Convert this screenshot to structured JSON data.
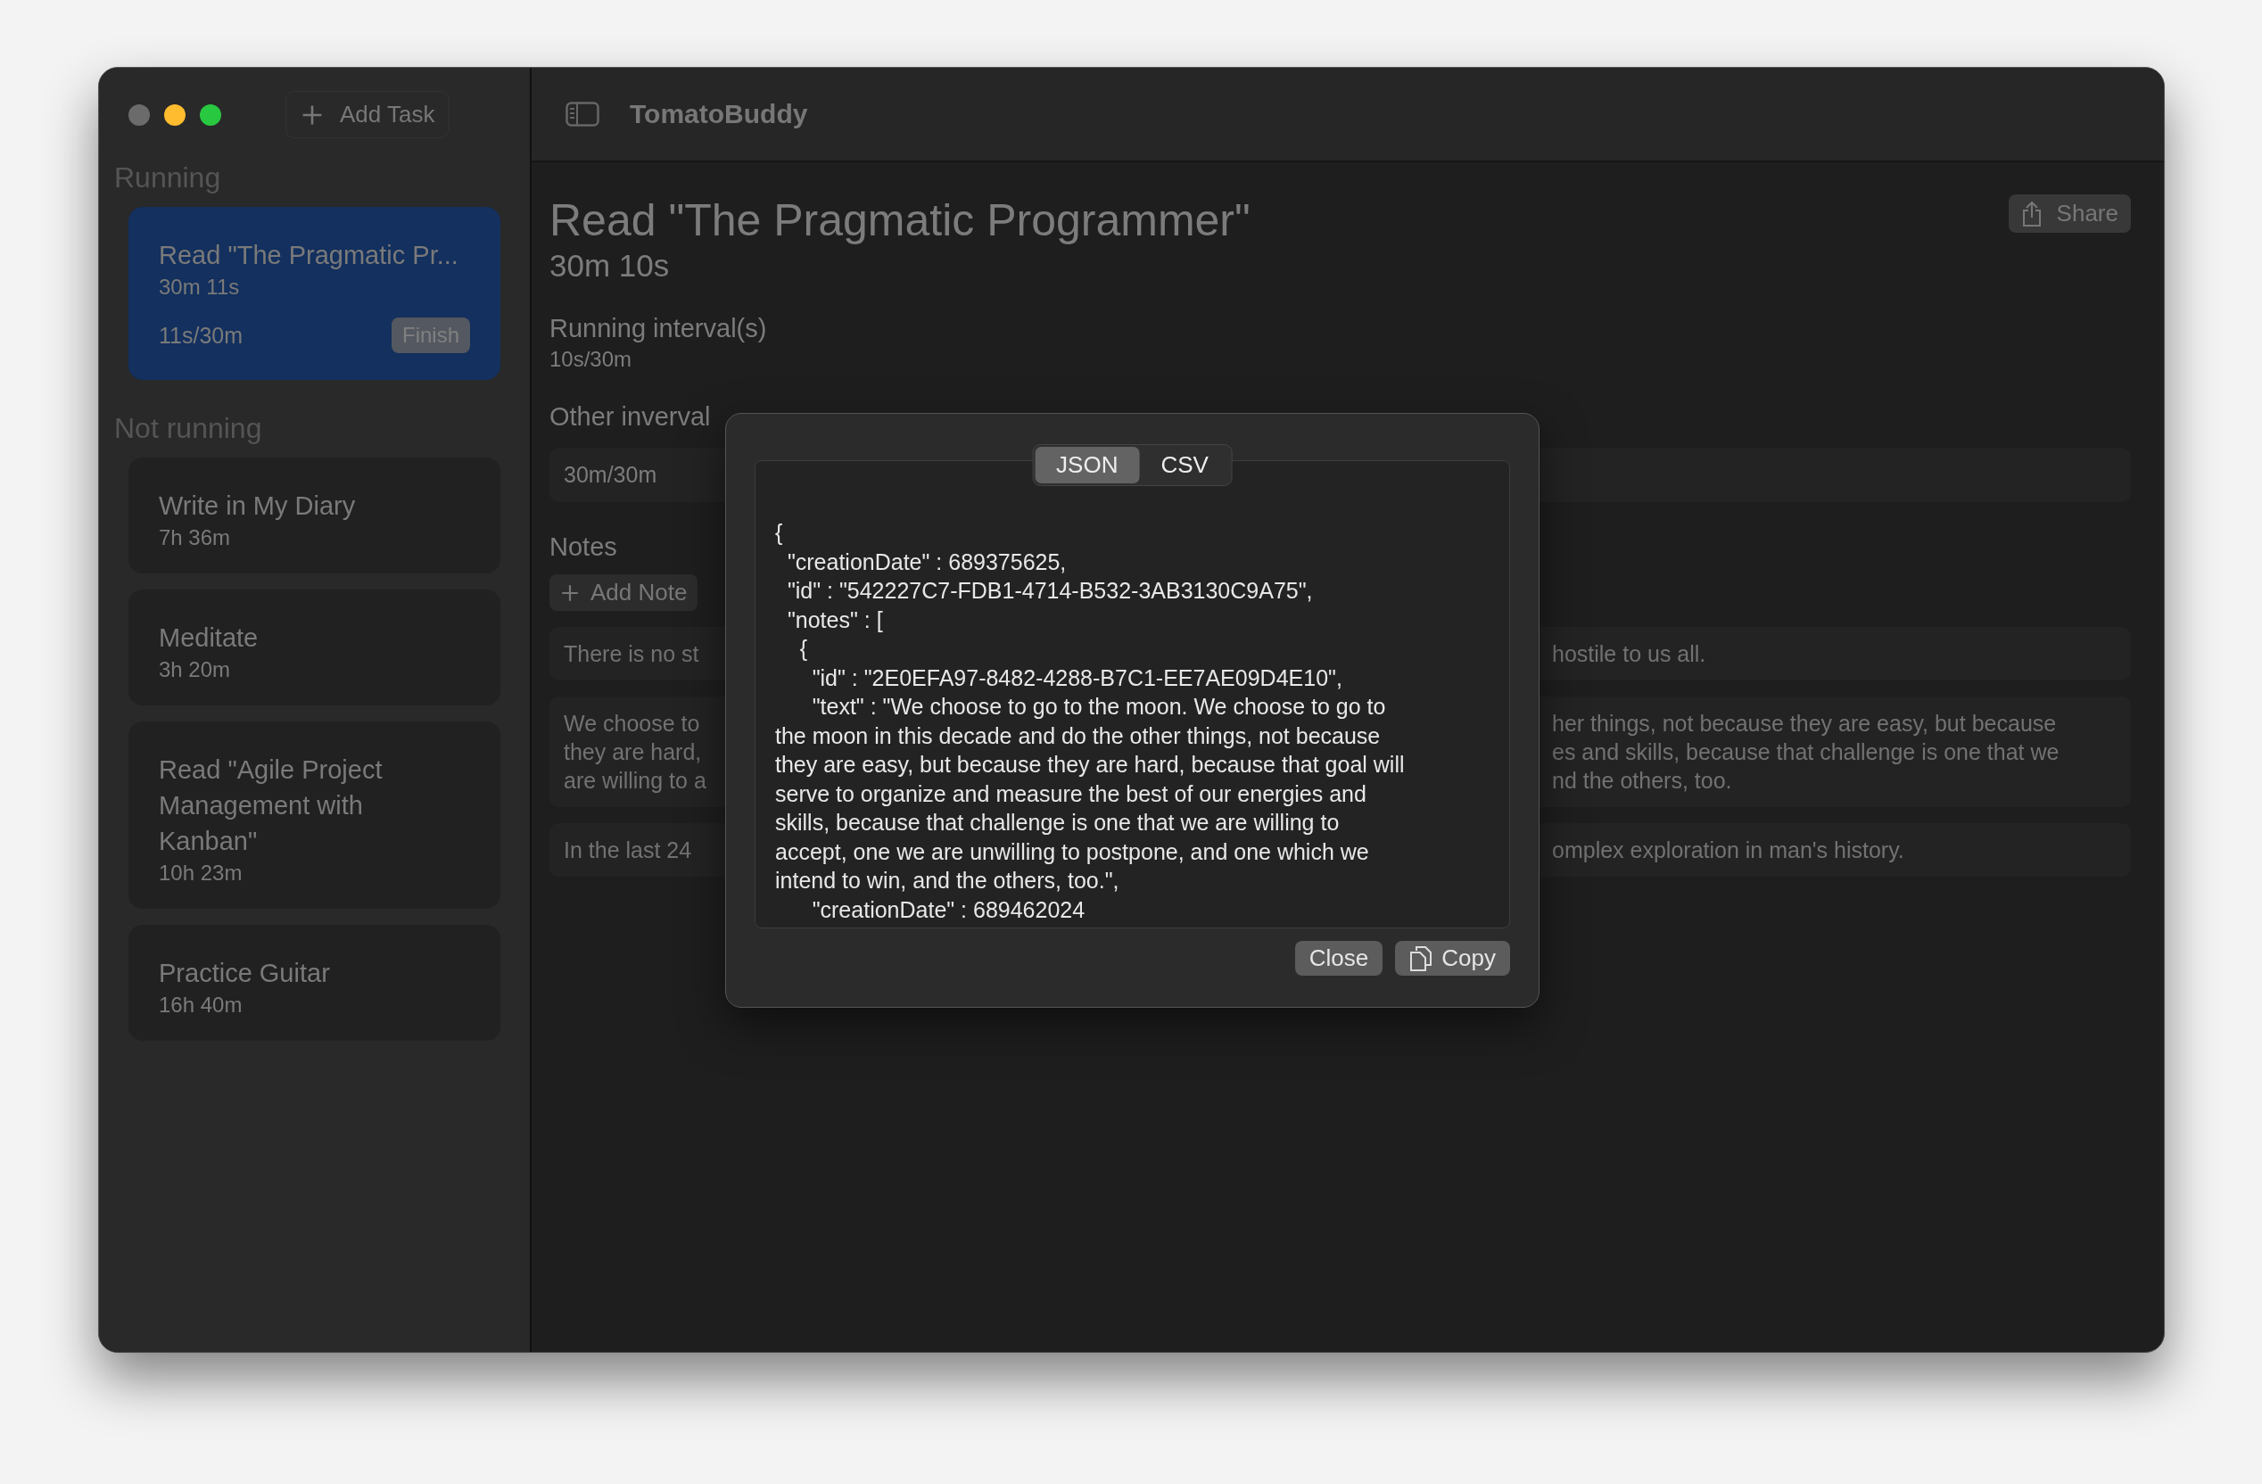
{
  "toolbar": {
    "add_task": "Add Task",
    "title": "TomatoBuddy"
  },
  "sidebar": {
    "sections": [
      {
        "title": "Running",
        "tasks": [
          {
            "kind": "running",
            "name": "Read \"The Pragmatic Pr...",
            "total": "30m 11s",
            "interval": "11s/30m",
            "action": "Finish",
            "selected": true
          }
        ]
      },
      {
        "title": "Not running",
        "tasks": [
          {
            "kind": "idle",
            "name": "Write in My Diary",
            "total": "7h 36m",
            "selected": false
          },
          {
            "kind": "idle",
            "name": "Meditate",
            "total": "3h 20m",
            "selected": false
          },
          {
            "kind": "idle",
            "name": "Read \"Agile Project Management with Kanban\"",
            "total": "10h 23m",
            "selected": false
          },
          {
            "kind": "idle",
            "name": "Practice Guitar",
            "total": "16h 40m",
            "selected": false
          }
        ]
      }
    ]
  },
  "detail": {
    "title": "Read \"The Pragmatic Programmer\"",
    "total": "30m 10s",
    "share": "Share",
    "running_label": "Running interval(s)",
    "running_value": "10s/30m",
    "other_label": "Other inverval",
    "other_rows": [
      "30m/30m"
    ],
    "notes_label": "Notes",
    "add_note": "Add Note",
    "notes": [
      {
        "left": [
          "There is no st"
        ],
        "right": [
          "hostile to us all."
        ]
      },
      {
        "left": [
          "We choose to",
          "they are hard,",
          "are willing to a"
        ],
        "right": [
          "her things, not because they are easy, but because",
          "es and skills, because that challenge is one that we",
          "nd the others, too."
        ]
      },
      {
        "left": [
          "In the last 24"
        ],
        "right": [
          "omplex exploration in man's history."
        ]
      }
    ]
  },
  "dialog": {
    "tabs": [
      {
        "label": "JSON",
        "selected": true
      },
      {
        "label": "CSV",
        "selected": false
      }
    ],
    "lines": [
      "{",
      "  \"creationDate\" : 689375625,",
      "  \"id\" : \"542227C7-FDB1-4714-B532-3AB3130C9A75\",",
      "  \"notes\" : [",
      "    {",
      "      \"id\" : \"2E0EFA97-8482-4288-B7C1-EE7AE09D4E10\",",
      "      \"text\" : \"We choose to go to the moon. We choose to go to",
      "the moon in this decade and do the other things, not because",
      "they are easy, but because they are hard, because that goal will",
      "serve to organize and measure the best of our energies and",
      "skills, because that challenge is one that we are willing to",
      "accept, one we are unwilling to postpone, and one which we",
      "intend to win, and the others, too.\",",
      "      \"creationDate\" : 689462024"
    ],
    "buttons": [
      {
        "kind": "close",
        "label": "Close"
      },
      {
        "kind": "copy",
        "label": "Copy"
      }
    ]
  }
}
